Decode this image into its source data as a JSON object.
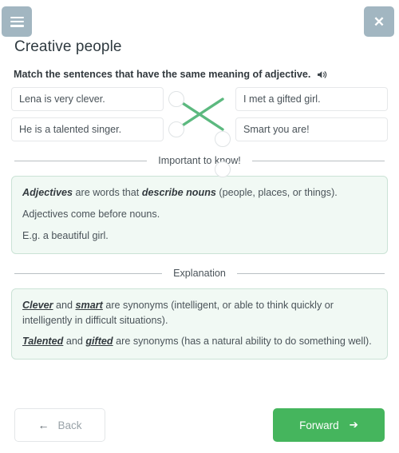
{
  "header": {
    "menu_icon": "hamburger-menu-icon",
    "close_icon": "✕",
    "title": "Creative people",
    "button_color": "#a2b6c1"
  },
  "task": {
    "instruction": "Match the sentences that have the same meaning of adjective.",
    "audio_icon": "speaker-icon",
    "left_items": [
      "Lena is very clever.",
      "He is a talented singer."
    ],
    "right_items": [
      "I met a gifted girl.",
      "Smart you are!"
    ],
    "connections": [
      {
        "from": 0,
        "to": 1
      },
      {
        "from": 1,
        "to": 0
      }
    ],
    "line_color": "#5cb97f"
  },
  "sections": [
    {
      "divider_label": "Important to know!",
      "lines": [
        {
          "parts": [
            {
              "text": "Adjectives",
              "style": "bold-italic"
            },
            {
              "text": " are words that ",
              "style": "normal"
            },
            {
              "text": "describe nouns",
              "style": "bold-italic"
            },
            {
              "text": " (people, places, or things).",
              "style": "normal"
            }
          ]
        },
        {
          "parts": [
            {
              "text": "Adjectives come before nouns.",
              "style": "normal"
            }
          ]
        },
        {
          "parts": [
            {
              "text": "E.g. a beautiful girl.",
              "style": "normal"
            }
          ]
        }
      ]
    },
    {
      "divider_label": "Explanation",
      "lines": [
        {
          "parts": [
            {
              "text": "Clever",
              "style": "bold-italic-underline"
            },
            {
              "text": " and ",
              "style": "normal"
            },
            {
              "text": "smart",
              "style": "bold-italic-underline"
            },
            {
              "text": " are synonyms (intelligent, or able to think quickly or intelligently in difficult situations).",
              "style": "normal"
            }
          ]
        },
        {
          "parts": [
            {
              "text": "Talented",
              "style": "bold-italic-underline"
            },
            {
              "text": " and ",
              "style": "normal"
            },
            {
              "text": "gifted",
              "style": "bold-italic-underline"
            },
            {
              "text": " are synonyms (has a natural ability to do something well).",
              "style": "normal"
            }
          ]
        }
      ]
    }
  ],
  "footer": {
    "back_label": "Back",
    "back_icon": "←",
    "forward_label": "Forward",
    "forward_icon": "➔",
    "forward_color": "#45b55d"
  }
}
